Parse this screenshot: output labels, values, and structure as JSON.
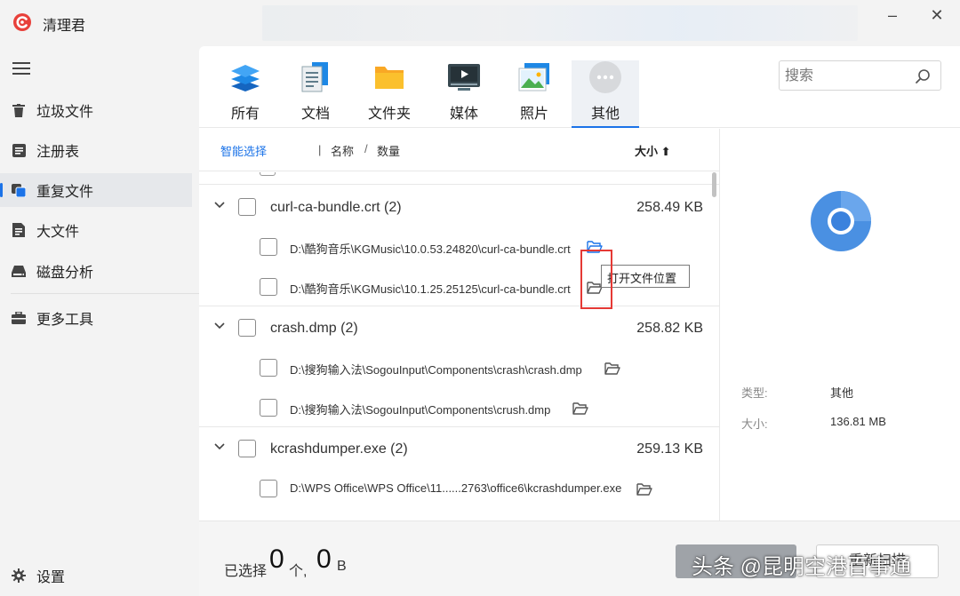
{
  "app": {
    "title": "清理君"
  },
  "sidebar": {
    "items": [
      {
        "label": "垃圾文件",
        "icon": "trash-icon"
      },
      {
        "label": "注册表",
        "icon": "registry-icon"
      },
      {
        "label": "重复文件",
        "icon": "duplicate-files-icon"
      },
      {
        "label": "大文件",
        "icon": "big-file-icon"
      },
      {
        "label": "磁盘分析",
        "icon": "disk-icon"
      },
      {
        "label": "更多工具",
        "icon": "toolbox-icon"
      }
    ],
    "settings_label": "设置"
  },
  "tabs": [
    {
      "label": "所有",
      "icon": "layers-icon"
    },
    {
      "label": "文档",
      "icon": "document-icon"
    },
    {
      "label": "文件夹",
      "icon": "folder-icon"
    },
    {
      "label": "媒体",
      "icon": "media-icon"
    },
    {
      "label": "照片",
      "icon": "photo-icon"
    },
    {
      "label": "其他",
      "icon": "more-icon"
    }
  ],
  "search": {
    "placeholder": "搜索"
  },
  "list_header": {
    "smart_select": "智能选择",
    "separator": "|",
    "name": "名称",
    "slash": "/",
    "count": "数量",
    "size": "大小 ⬆"
  },
  "groups": [
    {
      "name": "curl-ca-bundle.crt (2)",
      "size": "258.49 KB",
      "files": [
        "D:\\酷狗音乐\\KGMusic\\10.0.53.24820\\curl-ca-bundle.crt",
        "D:\\酷狗音乐\\KGMusic\\10.1.25.25125\\curl-ca-bundle.crt"
      ]
    },
    {
      "name": "crash.dmp (2)",
      "size": "258.82 KB",
      "files": [
        "D:\\搜狗输入法\\SogouInput\\Components\\crash\\crash.dmp",
        "D:\\搜狗输入法\\SogouInput\\Components\\crush.dmp"
      ]
    },
    {
      "name": "kcrashdumper.exe (2)",
      "size": "259.13 KB",
      "files": [
        "D:\\WPS Office\\WPS Office\\11......2763\\office6\\kcrashdumper.exe"
      ]
    }
  ],
  "tooltip": "打开文件位置",
  "detail": {
    "type_label": "类型:",
    "type_value": "其他",
    "size_label": "大小:",
    "size_value": "136.81 MB"
  },
  "footer": {
    "selected_prefix": "已选择",
    "count": "0",
    "count_unit": "个,",
    "bytes": "0",
    "bytes_unit": "B",
    "secondary_button": "重新扫描"
  },
  "watermark": "头条 @昆明空港百事通",
  "colors": {
    "accent": "#1b73e8",
    "highlight": "#e53935",
    "logo": "#e8403a"
  }
}
